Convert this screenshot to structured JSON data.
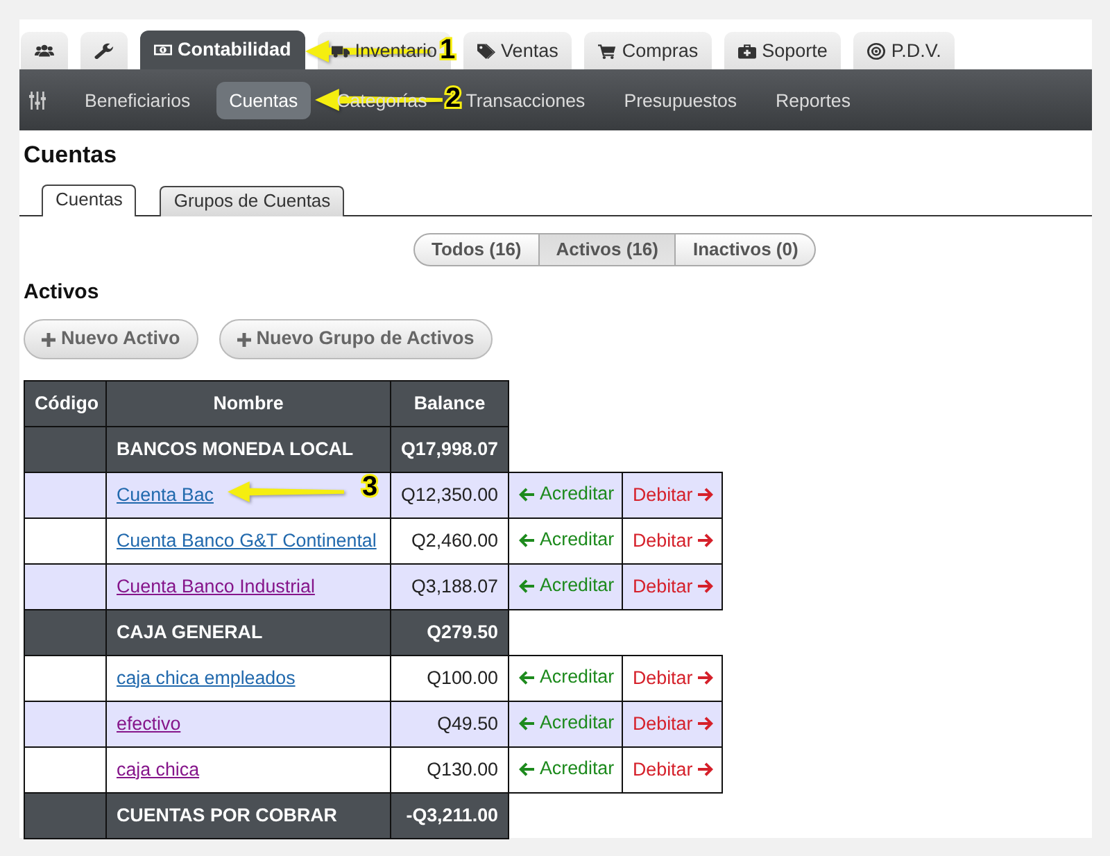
{
  "main_tabs": [
    {
      "selected": false
    },
    {
      "selected": false
    },
    {
      "label": "Contabilidad",
      "selected": true
    },
    {
      "label": "Inventario",
      "selected": false
    },
    {
      "label": "Ventas",
      "selected": false
    },
    {
      "label": "Compras",
      "selected": false
    },
    {
      "label": "Soporte",
      "selected": false
    },
    {
      "label": "P.D.V.",
      "selected": false
    }
  ],
  "sub_nav": [
    {
      "label": "Beneficiarios",
      "selected": false
    },
    {
      "label": "Cuentas",
      "selected": true
    },
    {
      "label": "Categorías",
      "selected": false
    },
    {
      "label": "Transacciones",
      "selected": false
    },
    {
      "label": "Presupuestos",
      "selected": false
    },
    {
      "label": "Reportes",
      "selected": false
    }
  ],
  "page_title": "Cuentas",
  "section_tabs": [
    {
      "label": "Cuentas",
      "selected": true
    },
    {
      "label": "Grupos de Cuentas",
      "selected": false
    }
  ],
  "filter_buttons": [
    {
      "label": "Todos (16)",
      "selected": false
    },
    {
      "label": "Activos (16)",
      "selected": true
    },
    {
      "label": "Inactivos (0)",
      "selected": false
    }
  ],
  "section_title": "Activos",
  "action_buttons": [
    {
      "label": "Nuevo Activo"
    },
    {
      "label": "Nuevo Grupo de Activos"
    }
  ],
  "table": {
    "columns": [
      "Código",
      "Nombre",
      "Balance"
    ],
    "rows": [
      {
        "kind": "group",
        "name": "BANCOS MONEDA LOCAL",
        "balance": "Q17,998.07"
      },
      {
        "kind": "account",
        "name": "Cuenta Bac",
        "balance": "Q12,350.00",
        "visited": false,
        "credit": "Acreditar",
        "debit": "Debitar"
      },
      {
        "kind": "account",
        "name": "Cuenta Banco G&T Continental",
        "balance": "Q2,460.00",
        "visited": false,
        "credit": "Acreditar",
        "debit": "Debitar"
      },
      {
        "kind": "account",
        "name": "Cuenta Banco Industrial",
        "balance": "Q3,188.07",
        "visited": true,
        "credit": "Acreditar",
        "debit": "Debitar"
      },
      {
        "kind": "group",
        "name": "CAJA GENERAL",
        "balance": "Q279.50"
      },
      {
        "kind": "account",
        "name": "caja chica empleados",
        "balance": "Q100.00",
        "visited": false,
        "credit": "Acreditar",
        "debit": "Debitar"
      },
      {
        "kind": "account",
        "name": "efectivo",
        "balance": "Q49.50",
        "visited": true,
        "credit": "Acreditar",
        "debit": "Debitar"
      },
      {
        "kind": "account",
        "name": "caja chica",
        "balance": "Q130.00",
        "visited": true,
        "credit": "Acreditar",
        "debit": "Debitar"
      },
      {
        "kind": "group",
        "name": "CUENTAS POR COBRAR",
        "balance": "-Q3,211.00"
      }
    ]
  },
  "annotations": [
    {
      "number": "1"
    },
    {
      "number": "2"
    },
    {
      "number": "3"
    }
  ]
}
